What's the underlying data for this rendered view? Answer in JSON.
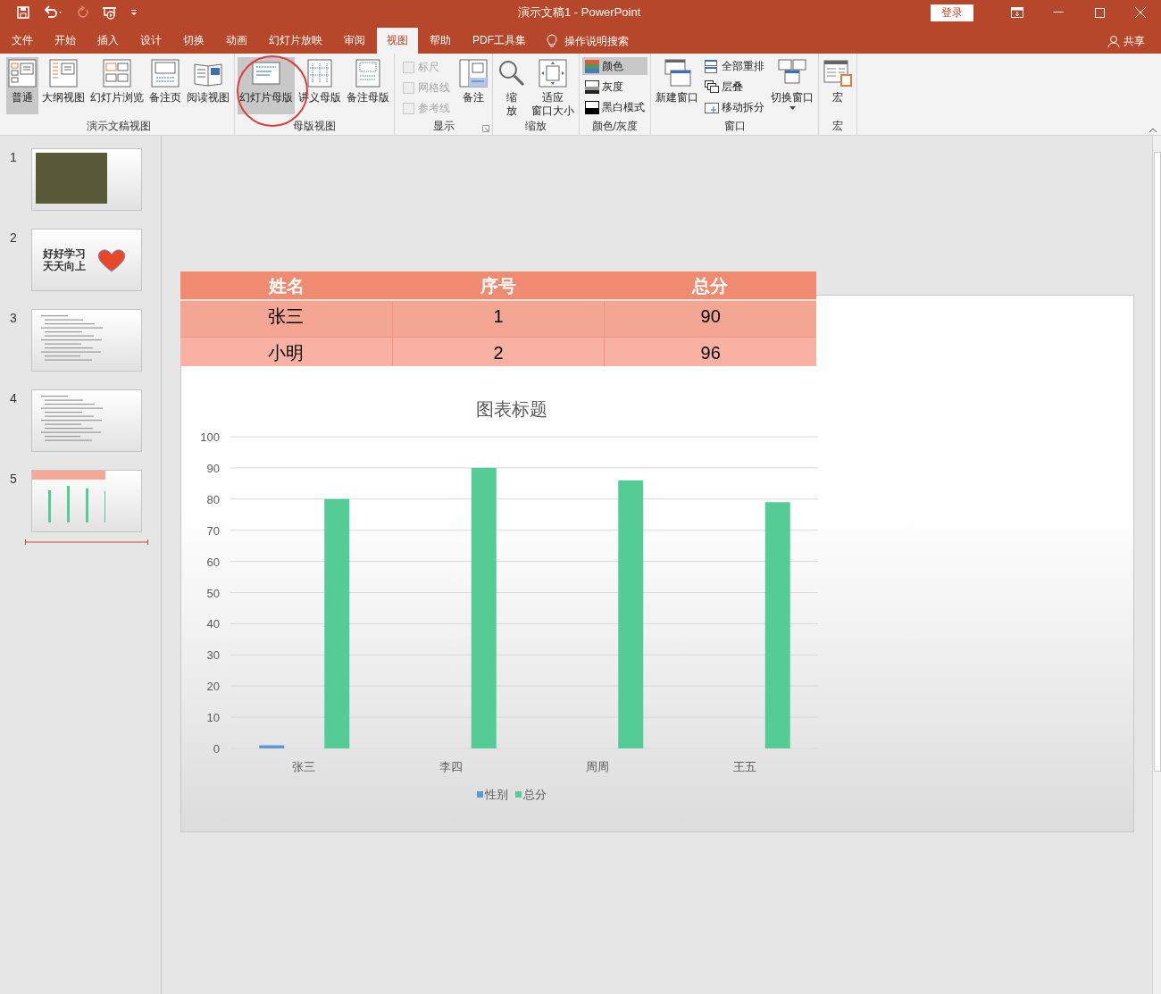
{
  "window": {
    "title": "演示文稿1  -  PowerPoint",
    "login": "登录"
  },
  "tabs": [
    {
      "label": "文件",
      "selected": false
    },
    {
      "label": "开始",
      "selected": false
    },
    {
      "label": "插入",
      "selected": false
    },
    {
      "label": "设计",
      "selected": false
    },
    {
      "label": "切换",
      "selected": false
    },
    {
      "label": "动画",
      "selected": false
    },
    {
      "label": "幻灯片放映",
      "selected": false
    },
    {
      "label": "审阅",
      "selected": false
    },
    {
      "label": "视图",
      "selected": true
    },
    {
      "label": "帮助",
      "selected": false
    },
    {
      "label": "PDF工具集",
      "selected": false
    }
  ],
  "tell_me": "操作说明搜索",
  "share": "共享",
  "ribbon_groups": [
    {
      "label": "演示文稿视图",
      "items": [
        {
          "kind": "large",
          "lines": [
            "普通"
          ],
          "selected": true
        },
        {
          "kind": "large",
          "lines": [
            "大纲视图"
          ],
          "selected": false
        },
        {
          "kind": "large",
          "lines": [
            "幻灯片浏览"
          ],
          "selected": false
        },
        {
          "kind": "large",
          "lines": [
            "备注页"
          ],
          "selected": false
        },
        {
          "kind": "large",
          "lines": [
            "阅读视图"
          ],
          "selected": false
        }
      ]
    },
    {
      "label": "母版视图",
      "items": [
        {
          "kind": "large",
          "lines": [
            "幻灯片母版"
          ],
          "selected": true
        },
        {
          "kind": "large",
          "lines": [
            "讲义母版"
          ],
          "selected": false
        },
        {
          "kind": "large",
          "lines": [
            "备注母版"
          ],
          "selected": false
        }
      ]
    },
    {
      "label": "显示",
      "items": [
        {
          "kind": "checks",
          "checks": [
            {
              "label": "标尺",
              "checked": false,
              "disabled": true
            },
            {
              "label": "网格线",
              "checked": false,
              "disabled": true
            },
            {
              "label": "参考线",
              "checked": false,
              "disabled": true
            }
          ]
        },
        {
          "kind": "large",
          "lines": [
            "备注"
          ],
          "selected": false
        }
      ]
    },
    {
      "label": "缩放",
      "items": [
        {
          "kind": "large",
          "lines": [
            "缩",
            "放"
          ],
          "selected": false
        },
        {
          "kind": "large",
          "lines": [
            "适应",
            "窗口大小"
          ],
          "selected": false
        }
      ]
    },
    {
      "label": "颜色/灰度",
      "items": [
        {
          "kind": "smalls",
          "smalls": [
            {
              "label": "颜色",
              "selected": true
            },
            {
              "label": "灰度",
              "selected": false
            },
            {
              "label": "黑白模式",
              "selected": false
            }
          ]
        }
      ]
    },
    {
      "label": "窗口",
      "items": [
        {
          "kind": "large",
          "lines": [
            "新建窗口"
          ],
          "selected": false
        },
        {
          "kind": "smalls",
          "smalls": [
            {
              "label": "全部重排",
              "selected": false
            },
            {
              "label": "层叠",
              "selected": false
            },
            {
              "label": "移动拆分",
              "selected": false
            }
          ]
        },
        {
          "kind": "large",
          "lines": [
            "切换窗口"
          ],
          "selected": false
        }
      ]
    },
    {
      "label": "宏",
      "items": [
        {
          "kind": "large",
          "lines": [
            "宏"
          ],
          "selected": false
        }
      ]
    }
  ],
  "slides": [
    {
      "number": "1",
      "kind": "photo"
    },
    {
      "number": "2",
      "kind": "text_heart",
      "texts": [
        "好好学习",
        "天天向上"
      ]
    },
    {
      "number": "3",
      "kind": "document"
    },
    {
      "number": "4",
      "kind": "document"
    },
    {
      "number": "5",
      "kind": "chart"
    }
  ],
  "table": {
    "columns": [
      "姓名",
      "序号",
      "总分"
    ],
    "rows": [
      [
        "张三",
        "1",
        "90"
      ],
      [
        "小明",
        "2",
        "96"
      ]
    ]
  },
  "chart_data": {
    "type": "bar",
    "title": "图表标题",
    "categories": [
      "张三",
      "李四",
      "周周",
      "王五"
    ],
    "series": [
      {
        "name": "性别",
        "color": "#5b9bd5",
        "values": [
          1,
          0,
          0,
          0
        ]
      },
      {
        "name": "总分",
        "color": "#55cb96",
        "values": [
          80,
          90,
          86,
          79
        ]
      }
    ],
    "ylim": [
      0,
      100
    ],
    "yticks": [
      0,
      10,
      20,
      30,
      40,
      50,
      60,
      70,
      80,
      90,
      100
    ],
    "grid": true,
    "legend": "bottom"
  }
}
